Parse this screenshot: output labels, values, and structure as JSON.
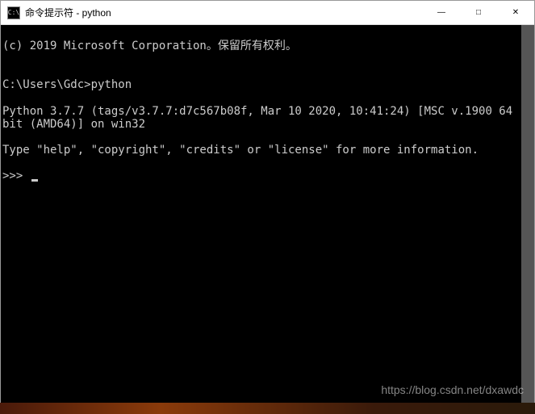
{
  "window": {
    "title": "命令提示符 - python",
    "icon_label": "C:\\"
  },
  "controls": {
    "minimize": "—",
    "maximize": "□",
    "close": "✕"
  },
  "console": {
    "line1": "(c) 2019 Microsoft Corporation。保留所有权利。",
    "blank1": "",
    "line2": "C:\\Users\\Gdc>python",
    "line3": "Python 3.7.7 (tags/v3.7.7:d7c567b08f, Mar 10 2020, 10:41:24) [MSC v.1900 64 bit (AMD64)] on win32",
    "line4": "Type \"help\", \"copyright\", \"credits\" or \"license\" for more information.",
    "prompt": ">>> "
  },
  "watermark": "https://blog.csdn.net/dxawdc"
}
